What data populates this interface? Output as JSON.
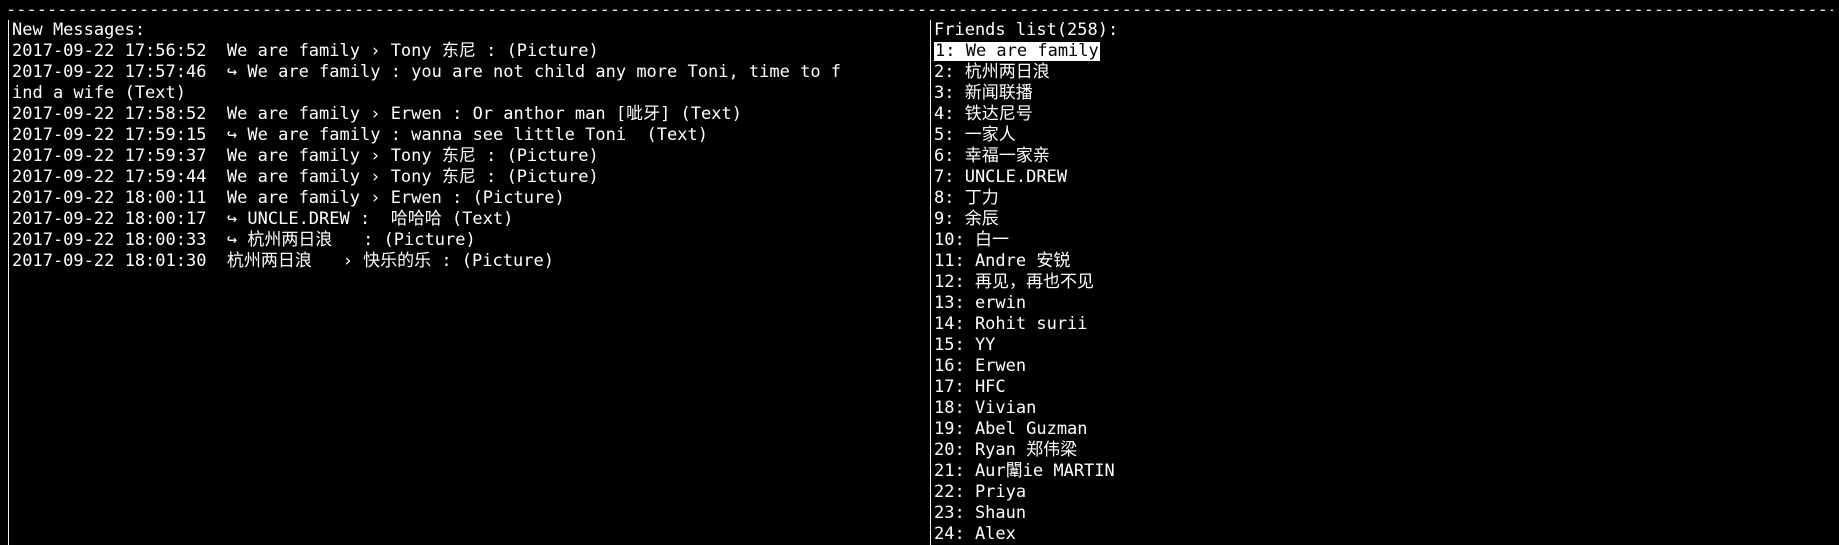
{
  "top_border": "-------------------------------------------------------------------------------------------------------------------------------------------------------------------------------------------------------------------------------------",
  "messages_pane": {
    "title": "New Messages:",
    "lines": [
      "2017-09-22 17:56:52  We are family › Tony 东尼 : (Picture)",
      "2017-09-22 17:57:46  ↪ We are family : you are not child any more Toni, time to f",
      "ind a wife (Text)",
      "2017-09-22 17:58:52  We are family › Erwen : Or anthor man [呲牙] (Text)",
      "2017-09-22 17:59:15  ↪ We are family : wanna see little Toni  (Text)",
      "2017-09-22 17:59:37  We are family › Tony 东尼 : (Picture)",
      "2017-09-22 17:59:44  We are family › Tony 东尼 : (Picture)",
      "2017-09-22 18:00:11  We are family › Erwen : (Picture)",
      "2017-09-22 18:00:17  ↪ UNCLE.DREW :  哈哈哈 (Text)",
      "2017-09-22 18:00:33  ↪ 杭州两日浪   : (Picture)",
      "2017-09-22 18:01:30  杭州两日浪   › 快乐的乐 : (Picture)"
    ]
  },
  "friends_pane": {
    "title": "Friends list(258):",
    "selected_item": "1: We are family",
    "items": [
      "2: 杭州两日浪",
      "3: 新闻联播",
      "4: 铁达尼号",
      "5: 一家人",
      "6: 幸福一家亲",
      "7: UNCLE.DREW",
      "8: 丁力",
      "9: 余辰",
      "10: 白一",
      "11: Andre 安锐",
      "12: 再见，再也不见",
      "13: erwin",
      "14: Rohit surii",
      "15: YY",
      "16: Erwen",
      "17: HFC",
      "18: Vivian",
      "19: Abel Guzman",
      "20: Ryan 郑伟梁",
      "21: Aur闈ie MARTIN",
      "22: Priya",
      "23: Shaun",
      "24: Alex"
    ]
  }
}
